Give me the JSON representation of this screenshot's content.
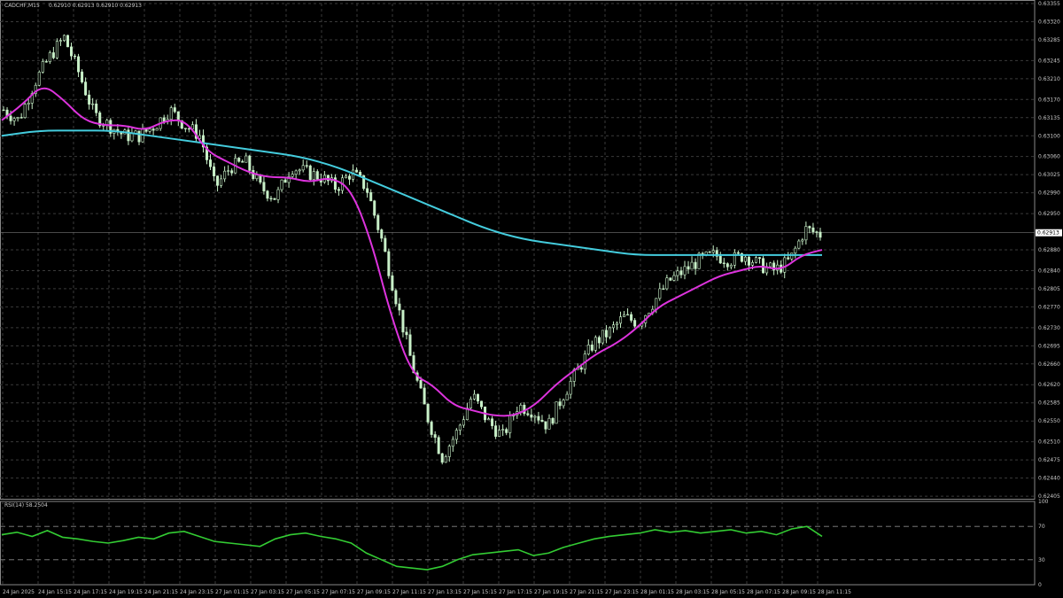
{
  "header": {
    "symbol": "CADCHF,M15",
    "ohlc": "0.62910 0.62913 0.62910 0.62913"
  },
  "rsi_header": "RSI(14) 58.2504",
  "colors": {
    "background": "#000000",
    "grid": "#3a3a3a",
    "bull_candle": "#c8f0c8",
    "bear_candle": "#c8f0c8",
    "ma_fast": "#dd33dd",
    "ma_slow": "#44ccdd",
    "rsi_line": "#33cc33",
    "axis_text": "#c8c8c8"
  },
  "chart_data": [
    {
      "type": "candlestick",
      "symbol": "CADCHF",
      "timeframe": "M15",
      "y_ticks": [
        "0.63355",
        "0.63320",
        "0.63285",
        "0.63245",
        "0.63210",
        "0.63170",
        "0.63135",
        "0.63100",
        "0.63060",
        "0.63025",
        "0.62990",
        "0.62950",
        "0.62880",
        "0.62840",
        "0.62805",
        "0.62770",
        "0.62730",
        "0.62695",
        "0.62660",
        "0.62620",
        "0.62585",
        "0.62550",
        "0.62510",
        "0.62475",
        "0.62440",
        "0.62405"
      ],
      "ylim": [
        0.624,
        0.63355
      ],
      "current_price": "0.62913",
      "x_labels": [
        "24 Jan 2025",
        "24 Jan 15:15",
        "24 Jan 17:15",
        "24 Jan 19:15",
        "24 Jan 21:15",
        "24 Jan 23:15",
        "27 Jan 01:15",
        "27 Jan 03:15",
        "27 Jan 05:15",
        "27 Jan 07:15",
        "27 Jan 09:15",
        "27 Jan 11:15",
        "27 Jan 13:15",
        "27 Jan 15:15",
        "27 Jan 17:15",
        "27 Jan 19:15",
        "27 Jan 21:15",
        "27 Jan 23:15",
        "28 Jan 01:15",
        "28 Jan 03:15",
        "28 Jan 05:15",
        "28 Jan 07:15",
        "28 Jan 09:15",
        "28 Jan 11:15"
      ],
      "close_path": [
        0.6315,
        0.6313,
        0.632,
        0.6325,
        0.6329,
        0.6322,
        0.6314,
        0.6312,
        0.631,
        0.631,
        0.6312,
        0.6315,
        0.6312,
        0.631,
        0.63,
        0.6304,
        0.6305,
        0.63,
        0.6298,
        0.6304,
        0.6303,
        0.6302,
        0.63,
        0.6303,
        0.63,
        0.629,
        0.6278,
        0.6266,
        0.6256,
        0.6248,
        0.6253,
        0.626,
        0.6255,
        0.6252,
        0.6258,
        0.6257,
        0.6254,
        0.626,
        0.6265,
        0.627,
        0.6272,
        0.6275,
        0.6274,
        0.6278,
        0.6282,
        0.6284,
        0.6286,
        0.6287,
        0.6286,
        0.6287,
        0.6285,
        0.6284,
        0.6286,
        0.6292,
        0.6291
      ],
      "ma_fast": [
        0.6313,
        0.6316,
        0.632,
        0.6317,
        0.6313,
        0.6312,
        0.6312,
        0.6311,
        0.6313,
        0.6313,
        0.6307,
        0.6305,
        0.6303,
        0.6302,
        0.6302,
        0.6301,
        0.6302,
        0.63,
        0.629,
        0.6275,
        0.6264,
        0.6262,
        0.6258,
        0.6257,
        0.6256,
        0.6256,
        0.6258,
        0.6262,
        0.6265,
        0.6268,
        0.627,
        0.6273,
        0.6277,
        0.6279,
        0.6281,
        0.6283,
        0.6284,
        0.6285,
        0.6284,
        0.6287,
        0.6288
      ],
      "ma_slow": [
        0.631,
        0.6311,
        0.6311,
        0.6311,
        0.631,
        0.6309,
        0.6308,
        0.6307,
        0.6306,
        0.6304,
        0.6301,
        0.6298,
        0.6295,
        0.6292,
        0.629,
        0.6289,
        0.6288,
        0.6287,
        0.6287,
        0.6287,
        0.6287,
        0.6287,
        0.6287
      ],
      "series": [
        {
          "name": "",
          "color": "#dd33dd"
        },
        {
          "name": "",
          "color": "#44ccdd"
        }
      ]
    },
    {
      "type": "line",
      "indicator": "RSI",
      "period": 14,
      "value": "58.2504",
      "ylim": [
        0,
        100
      ],
      "levels": [
        70,
        30
      ],
      "y_ticks": [
        "100",
        "70",
        "30",
        "0"
      ],
      "values": [
        60,
        63,
        58,
        65,
        57,
        55,
        52,
        50,
        53,
        57,
        55,
        62,
        64,
        58,
        52,
        50,
        48,
        46,
        55,
        60,
        62,
        58,
        55,
        50,
        38,
        30,
        22,
        20,
        18,
        22,
        30,
        36,
        38,
        40,
        42,
        35,
        38,
        45,
        50,
        55,
        58,
        60,
        62,
        66,
        63,
        65,
        62,
        64,
        66,
        62,
        64,
        60,
        67,
        70,
        58
      ]
    }
  ]
}
